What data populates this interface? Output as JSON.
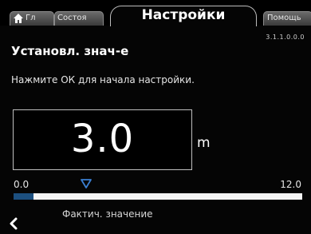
{
  "tabs": {
    "home": {
      "label": "Гл",
      "icon": "home-icon"
    },
    "status": {
      "label": "Состоя"
    },
    "active": {
      "label": "Настройки"
    },
    "help": {
      "label": "Помощь"
    }
  },
  "menu_code": "3.1.1.0.0.0",
  "page_title": "Установл. знач-е",
  "instruction": "Нажмите ОК для начала настройки.",
  "value": {
    "display": "3.0",
    "unit": "m",
    "numeric": 3.0
  },
  "scale": {
    "min_label": "0.0",
    "max_label": "12.0",
    "min": 0.0,
    "max": 12.0,
    "actual_fraction": 0.07
  },
  "actual_label": "Фактич. значение",
  "colors": {
    "background": "#050505",
    "accent_bar": "#1c4f7f",
    "pointer": "#3b7fd1",
    "track": "#f4f4f4"
  },
  "icons": {
    "back": "chevron-left-icon",
    "pointer": "triangle-down-icon"
  }
}
